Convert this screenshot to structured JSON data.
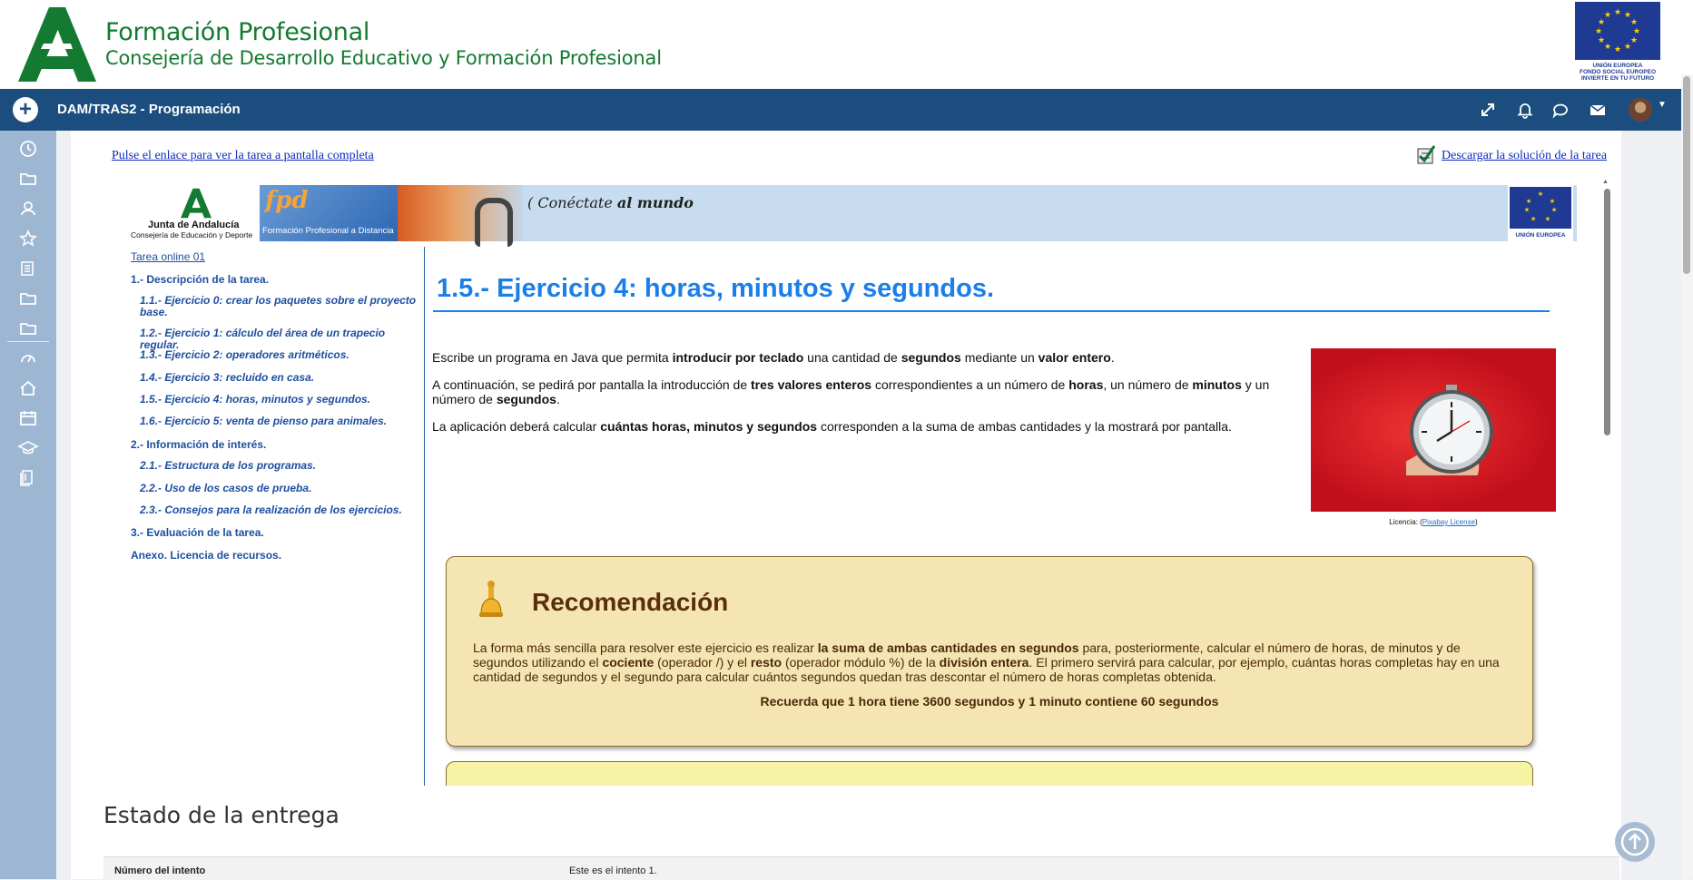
{
  "header": {
    "title": "Formación Profesional",
    "subtitle": "Consejería de Desarrollo Educativo y Formación Profesional",
    "eu_caption": [
      "UNIÓN EUROPEA",
      "FONDO SOCIAL EUROPEO",
      "INVIERTE EN TU FUTURO"
    ]
  },
  "navbar": {
    "course_title": "DAM/TRAS2 - Programación",
    "icons": [
      "expand-icon",
      "bell-icon",
      "chat-icon",
      "mail-icon",
      "user-avatar"
    ]
  },
  "drawer": {
    "icons": [
      "clock-icon",
      "folder-icon",
      "users-icon",
      "star-icon",
      "book-icon",
      "folder-icon",
      "folder-icon",
      "dashboard-icon",
      "home-icon",
      "calendar-icon",
      "graduation-icon",
      "courses-icon"
    ]
  },
  "links": {
    "fullscreen": "Pulse el enlace para ver la tarea a pantalla completa",
    "solution": "Descargar la solución de la tarea"
  },
  "banner": {
    "junta_name": "Junta de Andalucía",
    "junta_sub": "Consejería de Educación y Deporte",
    "fpd_logo": "fpd",
    "fpd_text": "Formación Profesional a Distancia",
    "tagline_1": "Conéctate",
    "tagline_2": "al mundo",
    "eu_caption": "UNIÓN EUROPEA"
  },
  "toc": {
    "head": "Tarea online 01",
    "items": [
      {
        "level": 1,
        "text": "1.- Descripción de la tarea."
      },
      {
        "level": 2,
        "text": "1.1.- Ejercicio 0: crear los paquetes sobre el proyecto base."
      },
      {
        "level": 2,
        "text": "1.2.- Ejercicio 1: cálculo del área de un trapecio regular."
      },
      {
        "level": 2,
        "text": "1.3.- Ejercicio 2: operadores aritméticos."
      },
      {
        "level": 2,
        "text": "1.4.- Ejercicio 3: recluido en casa."
      },
      {
        "level": 2,
        "text": "1.5.- Ejercicio 4: horas, minutos y segundos."
      },
      {
        "level": 2,
        "text": "1.6.- Ejercicio 5: venta de pienso para animales."
      },
      {
        "level": 1,
        "text": "2.- Información de interés."
      },
      {
        "level": 2,
        "text": "2.1.- Estructura de los programas."
      },
      {
        "level": 2,
        "text": "2.2.- Uso de los casos de prueba."
      },
      {
        "level": 2,
        "text": "2.3.- Consejos para la realización de los ejercicios."
      },
      {
        "level": 1,
        "text": "3.- Evaluación de la tarea."
      },
      {
        "level": 1,
        "text": "Anexo. Licencia de recursos."
      }
    ]
  },
  "content": {
    "title": "1.5.- Ejercicio 4: horas, minutos y segundos.",
    "p1": {
      "t1": "Escribe un programa en Java que permita ",
      "b1": "introducir por teclado",
      "t2": " una cantidad de ",
      "b2": "segundos",
      "t3": " mediante un ",
      "b3": "valor entero",
      "t4": "."
    },
    "p2": {
      "t1": "A continuación, se pedirá por pantalla la introducción de ",
      "b1": "tres valores enteros",
      "t2": " correspondientes a un número de ",
      "b2": "horas",
      "t3": ", un número de ",
      "b3": "minutos",
      "t4": " y un número de ",
      "b4": "segundos",
      "t5": "."
    },
    "p3": {
      "t1": "La aplicación deberá calcular ",
      "b1": "cuántas horas, minutos y segundos",
      "t2": " corresponden a la suma de ambas cantidades y la mostrará por pantalla."
    },
    "image_caption_prefix": "Licencia: (",
    "image_caption_link": "Pixabay License",
    "image_caption_suffix": ")"
  },
  "recomendacion": {
    "title": "Recomendación",
    "t1": "La forma más sencilla para resolver este ejercicio es realizar ",
    "b1": "la suma de ambas cantidades en segundos",
    "t2": " para, posteriormente, calcular el número de horas, de minutos y de segundos utilizando el ",
    "b2": "cociente",
    "t3": " (operador /) y el ",
    "b3": "resto",
    "t4": " (operador módulo %) de la ",
    "b4": "división entera",
    "t5": ". El primero servirá para calcular, por ejemplo, cuántas horas completas hay en una cantidad de segundos y el segundo para calcular cuántos segundos quedan tras descontar el número de horas completas obtenida.",
    "note": "Recuerda que 1 hora tiene 3600 segundos y 1 minuto contiene 60 segundos"
  },
  "submission": {
    "heading": "Estado de la entrega",
    "row_label": "Número del intento",
    "row_value": "Este es el intento 1."
  },
  "colors": {
    "navbar": "#1b4e7e",
    "drawer": "#9db6d2",
    "brand_green": "#147a31",
    "title_blue": "#1c7ee8",
    "reco_bg": "#f5e5b3"
  }
}
